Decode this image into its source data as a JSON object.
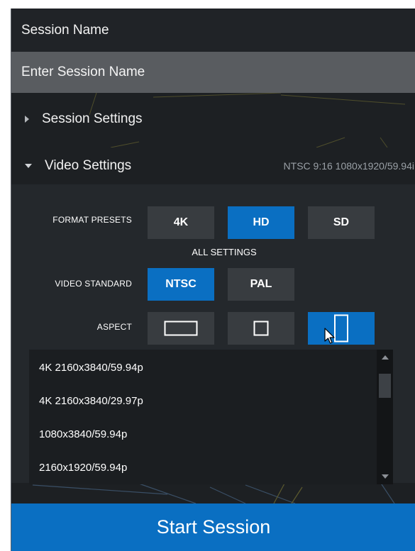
{
  "session_name": {
    "title": "Session Name",
    "placeholder": "Enter Session Name"
  },
  "sections": {
    "session_settings": {
      "label": "Session Settings",
      "expanded": false
    },
    "video_settings": {
      "label": "Video Settings",
      "expanded": true,
      "summary": "NTSC 9:16 1080x1920/59.94i"
    }
  },
  "video": {
    "format_presets": {
      "label": "FORMAT PRESETS",
      "options": [
        "4K",
        "HD",
        "SD"
      ],
      "selected": "HD"
    },
    "all_settings_label": "ALL SETTINGS",
    "video_standard": {
      "label": "VIDEO STANDARD",
      "options": [
        "NTSC",
        "PAL"
      ],
      "selected": "NTSC"
    },
    "aspect": {
      "label": "ASPECT",
      "options": [
        "landscape-16-9-icon",
        "square-4-3-icon",
        "portrait-9-16-icon"
      ],
      "selected": "portrait-9-16-icon"
    },
    "resolutions": [
      "4K 2160x3840/59.94p",
      "4K 2160x3840/29.97p",
      "1080x3840/59.94p",
      "2160x1920/59.94p"
    ]
  },
  "start_button": {
    "label": "Start Session"
  },
  "colors": {
    "accent": "#0a6fc2",
    "panel": "#1d2023",
    "input": "#595c60",
    "button": "#383c40"
  }
}
